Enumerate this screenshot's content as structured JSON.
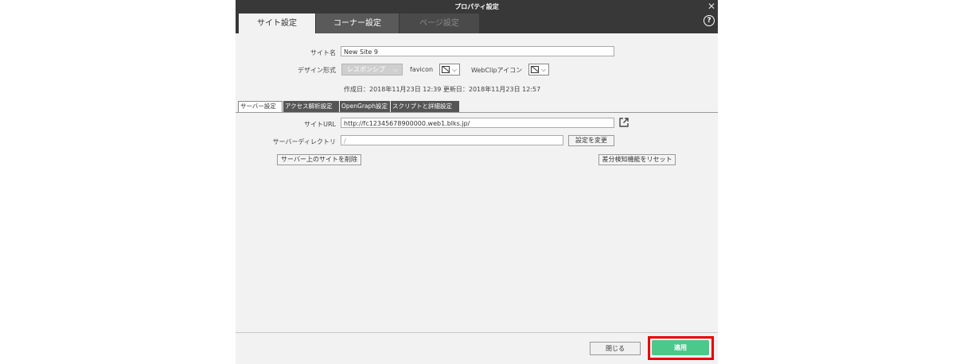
{
  "window": {
    "title": "プロパティ設定",
    "close_glyph": "✕",
    "help_glyph": "?"
  },
  "tabs": [
    {
      "label": "サイト設定",
      "state": "active"
    },
    {
      "label": "コーナー設定",
      "state": "normal"
    },
    {
      "label": "ページ設定",
      "state": "disabled"
    }
  ],
  "site": {
    "name_label": "サイト名",
    "name_value": "New Site 9",
    "design_label": "デザイン形式",
    "design_value": "レスポンシブ",
    "favicon_label": "favicon",
    "webclip_label": "WebClipアイコン",
    "created_label": "作成日：",
    "created_value": "2018年11月23日 12:39",
    "updated_label": "更新日：",
    "updated_value": "2018年11月23日 12:57"
  },
  "subtabs": [
    {
      "label": "サーバー設定",
      "state": "active"
    },
    {
      "label": "アクセス解析設定",
      "state": "normal"
    },
    {
      "label": "OpenGraph設定",
      "state": "normal"
    },
    {
      "label": "スクリプトと詳細設定",
      "state": "normal"
    }
  ],
  "server": {
    "url_label": "サイトURL",
    "url_value": "http://fc12345678900000.web1.blks.jp/",
    "dir_label": "サーバーディレクトリ",
    "dir_value": "/",
    "change_button": "設定を変更",
    "delete_button": "サーバー上のサイトを削除",
    "reset_button": "差分検知機能をリセット"
  },
  "footer": {
    "close_button": "閉じる",
    "apply_button": "適用"
  },
  "colors": {
    "titlebar": "#383838",
    "apply": "#4bc98a",
    "highlight": "#e60000"
  }
}
